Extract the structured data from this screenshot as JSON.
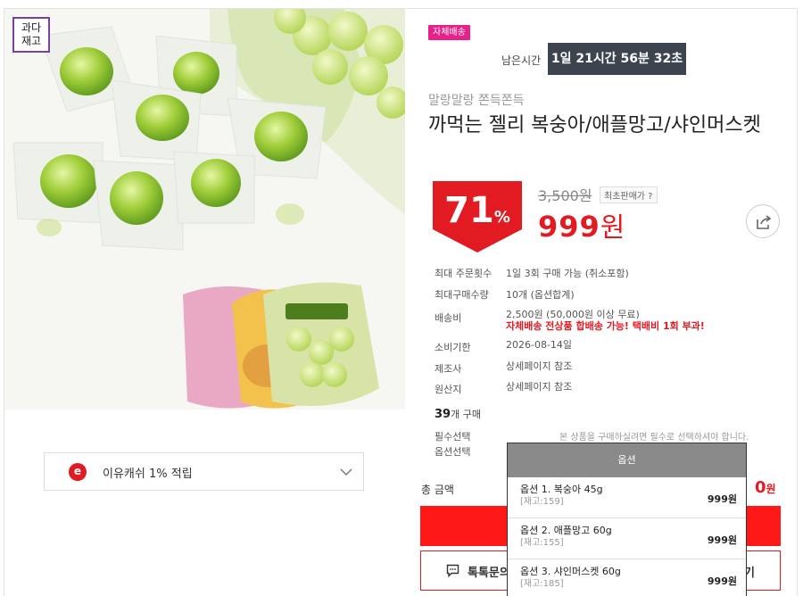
{
  "badge": {
    "line1": "과다",
    "line2": "재고"
  },
  "ecash": {
    "icon": "e",
    "text": "이유캐쉬 1% 적립"
  },
  "shipping_badge": "자체배송",
  "timer": {
    "label": "남은시간",
    "value": "1일 21시간 56분 32초"
  },
  "product": {
    "subtitle": "말랑말랑 쫀득쫀득",
    "title": "까먹는 젤리 복숭아/애플망고/샤인머스켓",
    "discount": "71",
    "discount_unit": "%",
    "original_price": "3,500원",
    "lowest_badge": "최초판매가 ?",
    "sale_price": "999",
    "sale_unit": "원"
  },
  "info": {
    "max_order_label": "최대 주문횟수",
    "max_order_value": "1일 3회 구매 가능 (취소포함)",
    "max_qty_label": "최대구매수량",
    "max_qty_value": "10개 (옵션합계)",
    "shipping_label": "배송비",
    "shipping_value": "2,500원 (50,000원 이상 무료)",
    "shipping_note": "자체배송 전상품 합배송 가능! 택배비 1회 부과!",
    "expiry_label": "소비기한",
    "expiry_value": "2026-08-14일",
    "maker_label": "제조사",
    "maker_value": "상세페이지 참조",
    "origin_label": "원산지",
    "origin_value": "상세페이지 참조"
  },
  "purchase": {
    "count": "39",
    "unit": "개 구매"
  },
  "options": {
    "required_label": "필수선택",
    "select_label": "옵션선택",
    "notice": "본 상품을 구매하실려면 필수로 선택하셔야 합니다.",
    "dropdown_header": "옵션",
    "items": [
      {
        "name": "옵션 1. 복숭아 45g",
        "stock": "[재고:159]",
        "price": "999원"
      },
      {
        "name": "옵션 2. 애플망고 60g",
        "stock": "[재고:155]",
        "price": "999원"
      },
      {
        "name": "옵션 3. 샤인머스켓 60g",
        "stock": "[재고:185]",
        "price": "999원"
      }
    ]
  },
  "total": {
    "label": "총 금액",
    "value": "0",
    "unit": "원"
  },
  "talk": {
    "label": "톡톡문의",
    "right": "기"
  },
  "colors": {
    "accent": "#e21b23",
    "badge_pink": "#e8208a",
    "timer_bg": "#3d4450",
    "buy_red": "#ff1818"
  }
}
